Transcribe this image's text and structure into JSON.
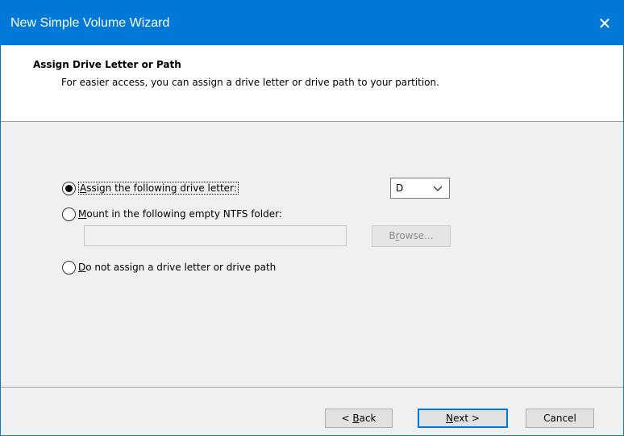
{
  "window": {
    "title": "New Simple Volume Wizard",
    "close_glyph": "✕"
  },
  "header": {
    "title": "Assign Drive Letter or Path",
    "subtitle": "For easier access, you can assign a drive letter or drive path to your partition."
  },
  "options": {
    "assign_letter": {
      "pre": "",
      "mnemonic": "A",
      "post": "ssign the following drive letter:",
      "checked": true
    },
    "mount_folder": {
      "pre": "",
      "mnemonic": "M",
      "post": "ount in the following empty NTFS folder:",
      "checked": false
    },
    "no_assign": {
      "pre": "",
      "mnemonic": "D",
      "post": "o not assign a drive letter or drive path",
      "checked": false
    }
  },
  "drive_select": {
    "value": "D",
    "icon": "chevron-down-icon"
  },
  "folder_path": {
    "value": ""
  },
  "browse_button": {
    "pre": "B",
    "mnemonic": "r",
    "post": "owse..."
  },
  "footer": {
    "back": {
      "pre": "< ",
      "mnemonic": "B",
      "post": "ack"
    },
    "next": {
      "pre": "",
      "mnemonic": "N",
      "post": "ext >"
    },
    "cancel": {
      "label": "Cancel"
    }
  },
  "colors": {
    "titlebar": "#0078d7",
    "dialog_bg": "#f0f0f0",
    "default_button_border": "#0078d7"
  }
}
